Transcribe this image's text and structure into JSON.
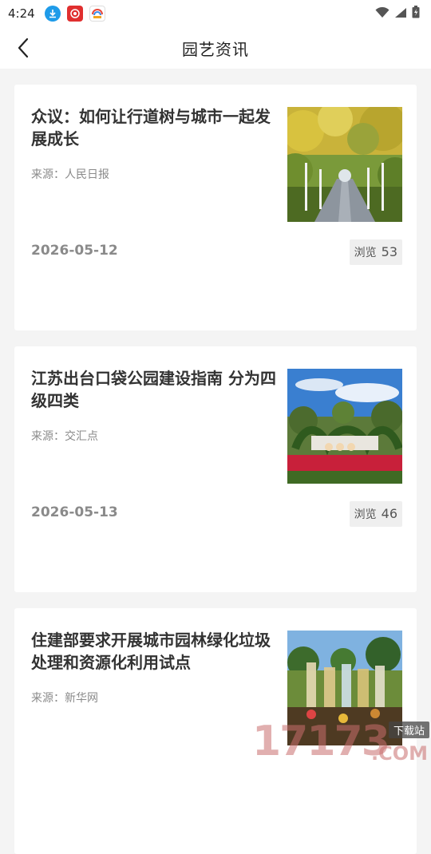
{
  "status_bar": {
    "time": "4:24",
    "notification_icons": [
      "download-icon",
      "app-icon-red",
      "app-icon-multicolor"
    ],
    "system_icons": [
      "wifi-icon",
      "signal-icon",
      "battery-icon"
    ]
  },
  "header": {
    "title": "园艺资讯",
    "back_icon": "chevron-left-icon"
  },
  "news": [
    {
      "title": "众议：如何让行道树与城市一起发展成长",
      "source": "来源：人民日报",
      "date": "2026-05-12",
      "views_label": "浏览",
      "views": "53",
      "thumbnail": "tree-lined-road-image"
    },
    {
      "title": "江苏出台口袋公园建设指南 分为四级四类",
      "source": "来源：交汇点",
      "date": "2026-05-13",
      "views_label": "浏览",
      "views": "46",
      "thumbnail": "park-topiary-image"
    },
    {
      "title": "住建部要求开展城市园林绿化垃圾处理和资源化利用试点",
      "source": "来源：新华网",
      "date": "",
      "views_label": "",
      "views": "",
      "thumbnail": "garden-exhibit-image"
    }
  ],
  "watermark": {
    "text": "17173",
    "tag": "下载站",
    "suffix": ".COM"
  },
  "colors": {
    "background": "#f4f4f4",
    "card": "#ffffff",
    "title_text": "#333333",
    "muted_text": "#8a8a8a",
    "badge_bg": "#efefef"
  }
}
